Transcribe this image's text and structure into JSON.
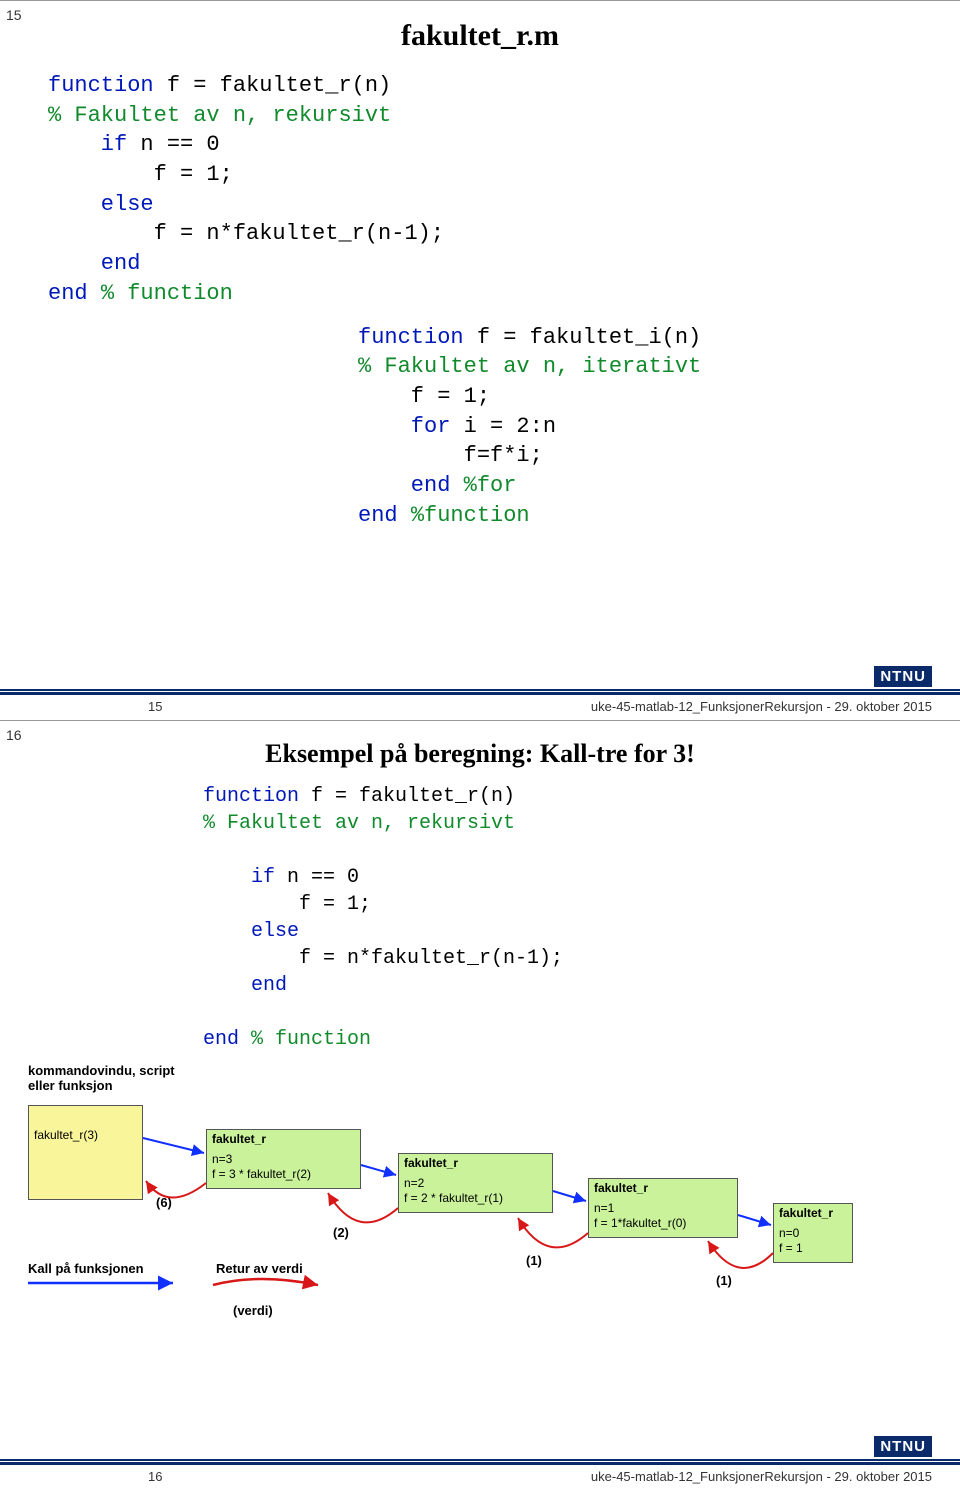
{
  "slide1": {
    "corner": "15",
    "title": "fakultet_r.m",
    "code_a": {
      "l1a": "function",
      "l1b": " f = fakultet_r(n)",
      "l2": "% Fakultet av n, rekursivt",
      "l3a": "    if",
      "l3b": " n == 0",
      "l4": "        f = 1;",
      "l5": "    else",
      "l6": "        f = n*fakultet_r(n-1);",
      "l7": "    end",
      "l8a": "end ",
      "l8b": "% function"
    },
    "code_b": {
      "l1a": "function",
      "l1b": " f = fakultet_i(n)",
      "l2": "% Fakultet av n, iterativt",
      "l3": "    f = 1;",
      "l4a": "    for",
      "l4b": " i = 2:n",
      "l5": "        f=f*i;",
      "l6a": "    end ",
      "l6b": "%for",
      "l7a": "end ",
      "l7b": "%function"
    },
    "footer_num": "15",
    "footer_txt": "uke-45-matlab-12_FunksjonerRekursjon - 29. oktober 2015",
    "ntnu": "NTNU"
  },
  "slide2": {
    "corner": "16",
    "title": "Eksempel på beregning: Kall-tre for 3!",
    "code": {
      "l1a": "function",
      "l1b": " f = fakultet_r(n)",
      "l2": "% Fakultet av n, rekursivt",
      "blank1": "",
      "l3a": "    if",
      "l3b": " n == 0",
      "l4": "        f = 1;",
      "l5": "    else",
      "l6": "        f = n*fakultet_r(n-1);",
      "l7": "    end",
      "blank2": "",
      "l8a": "end ",
      "l8b": "% function"
    },
    "diagram": {
      "caller_label": "kommandovindu, script\neller funksjon",
      "caller_call": "fakultet_r(3)",
      "legend_call": "Kall på funksjonen",
      "legend_return": "Retur av verdi",
      "legend_value": "(verdi)",
      "ret6": "(6)",
      "ret2": "(2)",
      "ret1a": "(1)",
      "ret1b": "(1)",
      "boxes": [
        {
          "hdr": "fakultet_r",
          "body": "n=3\nf = 3 * fakultet_r(2)"
        },
        {
          "hdr": "fakultet_r",
          "body": "n=2\nf = 2 * fakultet_r(1)"
        },
        {
          "hdr": "fakultet_r",
          "body": "n=1\nf = 1*fakultet_r(0)"
        },
        {
          "hdr": "fakultet_r",
          "body": "n=0\nf = 1"
        }
      ]
    },
    "footer_num": "16",
    "footer_txt": "uke-45-matlab-12_FunksjonerRekursjon - 29. oktober 2015",
    "ntnu": "NTNU"
  }
}
